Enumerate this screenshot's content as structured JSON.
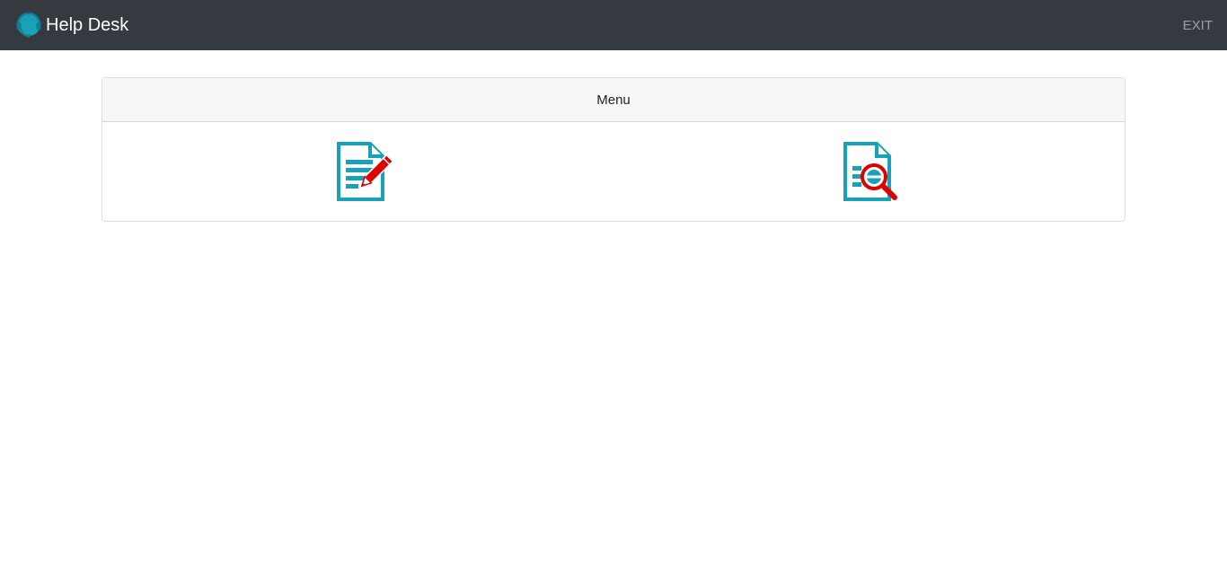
{
  "navbar": {
    "brand_title": "Help Desk",
    "brand_icon": "headset-icon",
    "exit_label": "EXIT",
    "background_color": "#343a40",
    "accent_color": "#17a2b8"
  },
  "menu": {
    "header_title": "Menu",
    "items": [
      {
        "icon": "document-edit-icon"
      },
      {
        "icon": "document-search-icon"
      }
    ],
    "icon_colors": {
      "document": "#17a2b8",
      "overlay": "#e00000"
    }
  }
}
